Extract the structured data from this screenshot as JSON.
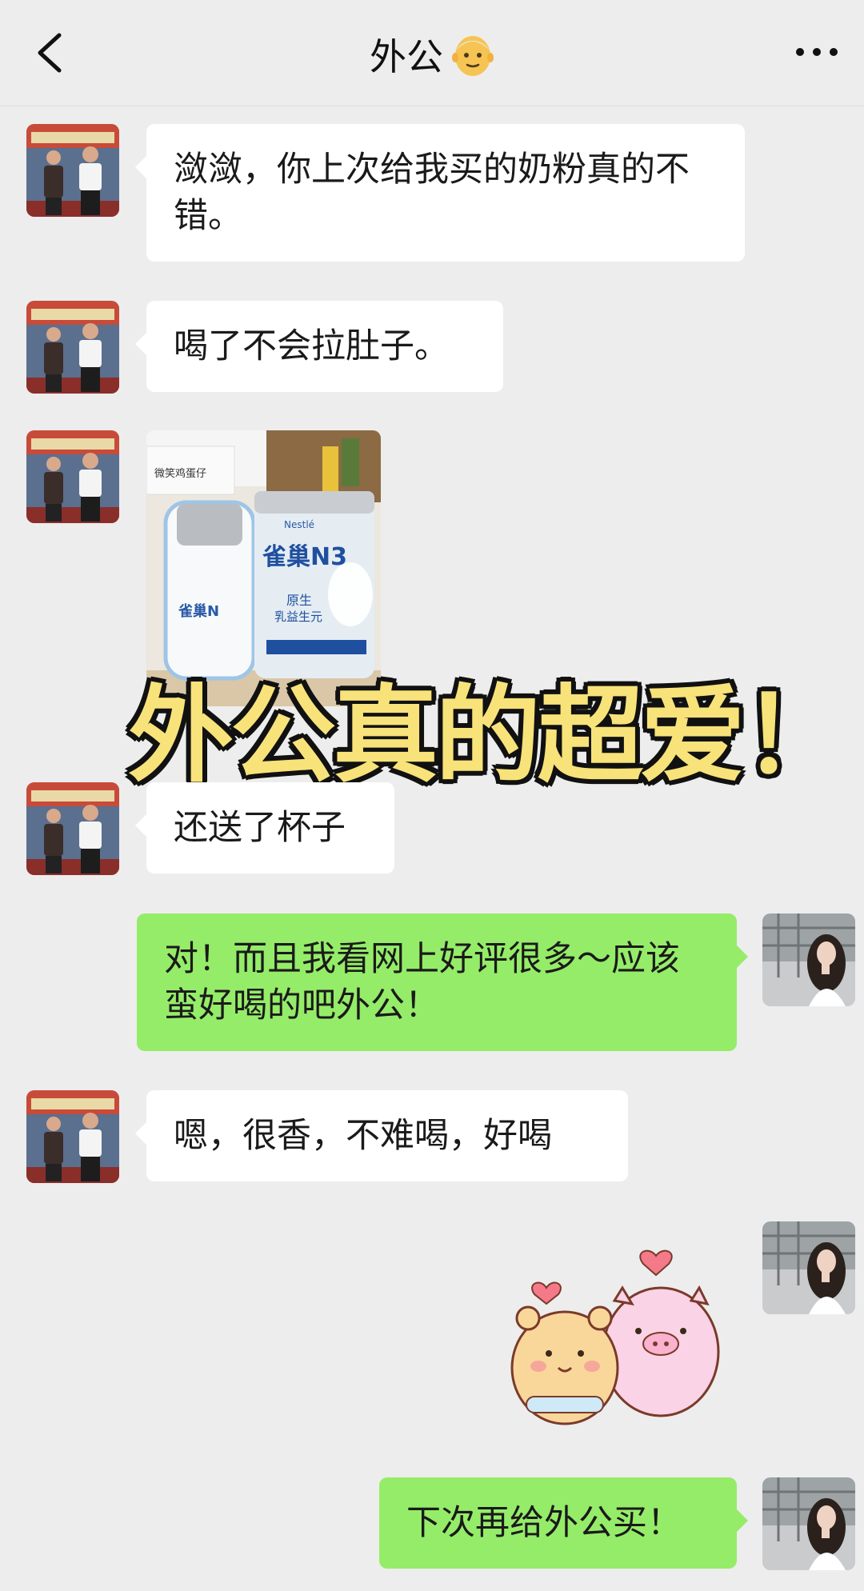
{
  "header": {
    "title": "外公",
    "title_emoji": "👴",
    "back_icon": "chevron-left-icon",
    "more_icon": "more-dots-icon"
  },
  "messages": [
    {
      "sender": "grandpa",
      "type": "text",
      "text": "潋潋，你上次给我买的奶粉真的不错。"
    },
    {
      "sender": "grandpa",
      "type": "text",
      "text": "喝了不会拉肚子。"
    },
    {
      "sender": "grandpa",
      "type": "image",
      "image_labels": {
        "product": "雀巢N3",
        "brand": "Nestlé",
        "sub1": "原生",
        "sub2": "乳益生元",
        "box": "微笑鸡蛋仔"
      }
    },
    {
      "sender": "grandpa",
      "type": "text",
      "text": "还送了杯子"
    },
    {
      "sender": "me",
      "type": "text",
      "text": "对！而且我看网上好评很多～应该蛮好喝的吧外公！"
    },
    {
      "sender": "grandpa",
      "type": "text",
      "text": "嗯，很香，不难喝，好喝"
    },
    {
      "sender": "me",
      "type": "sticker",
      "sticker": "bear-and-pig-hearts"
    },
    {
      "sender": "me",
      "type": "text",
      "text": "下次再给外公买！"
    }
  ],
  "overlay": {
    "text": "外公真的超爱！",
    "color": "#f8e27a",
    "outline": "#111111"
  },
  "colors": {
    "background": "#ededed",
    "bubble_left": "#ffffff",
    "bubble_right": "#95ec69"
  }
}
